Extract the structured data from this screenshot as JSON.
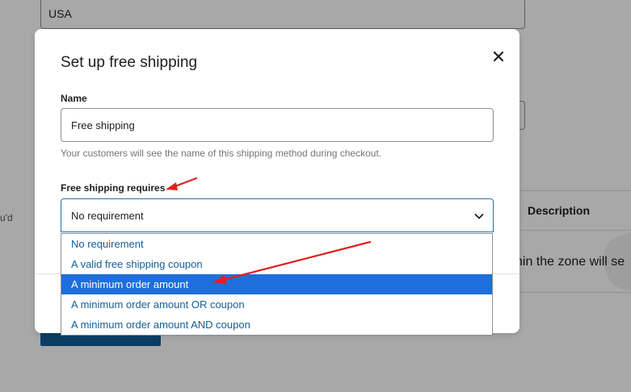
{
  "background": {
    "country_value": "USA",
    "side_text": "u'd",
    "table_header": "Description",
    "table_row_text": "hin the zone will se"
  },
  "modal": {
    "title": "Set up free shipping",
    "close_glyph": "✕",
    "name_label": "Name",
    "name_value": "Free shipping",
    "name_help": "Your customers will see the name of this shipping method during checkout.",
    "requires_label": "Free shipping requires",
    "requires_selected": "No requirement",
    "requires_options": [
      "No requirement",
      "A valid free shipping coupon",
      "A minimum order amount",
      "A minimum order amount OR coupon",
      "A minimum order amount AND coupon"
    ],
    "highlighted_option_index": 2
  },
  "colors": {
    "accent": "#2271b1",
    "highlight": "#1e6fd9",
    "option_text": "#135e96",
    "annotation_arrow": "#e02020"
  },
  "icons": {
    "close": "close-icon",
    "select_chevron": "chevron-down-icon",
    "annotation": "red-arrow"
  }
}
